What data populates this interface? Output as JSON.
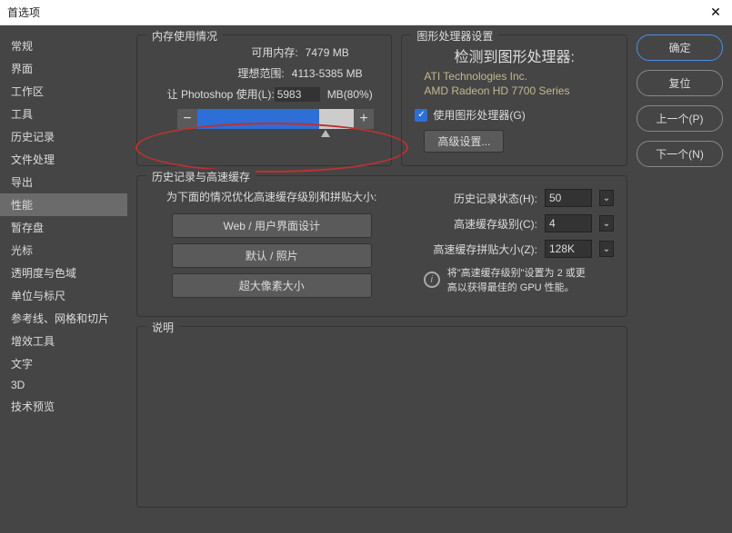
{
  "titlebar": {
    "title": "首选项"
  },
  "sidebar": {
    "items": [
      {
        "label": "常规"
      },
      {
        "label": "界面"
      },
      {
        "label": "工作区"
      },
      {
        "label": "工具"
      },
      {
        "label": "历史记录"
      },
      {
        "label": "文件处理"
      },
      {
        "label": "导出"
      },
      {
        "label": "性能"
      },
      {
        "label": "暂存盘"
      },
      {
        "label": "光标"
      },
      {
        "label": "透明度与色域"
      },
      {
        "label": "单位与标尺"
      },
      {
        "label": "参考线、网格和切片"
      },
      {
        "label": "增效工具"
      },
      {
        "label": "文字"
      },
      {
        "label": "3D"
      },
      {
        "label": "技术预览"
      }
    ],
    "selected_index": 7
  },
  "buttons": {
    "ok": "确定",
    "reset": "复位",
    "prev": "上一个(P)",
    "next": "下一个(N)"
  },
  "memory": {
    "title": "内存使用情况",
    "available_label": "可用内存:",
    "available_value": "7479 MB",
    "ideal_label": "理想范围:",
    "ideal_value": "4113-5385 MB",
    "let_label": "让 Photoshop 使用(L):",
    "let_value": "5983",
    "let_unit": "MB(80%)",
    "minus": "−",
    "plus": "+"
  },
  "gpu": {
    "title": "图形处理器设置",
    "detected_label": "检测到图形处理器:",
    "vendor": "ATI Technologies Inc.",
    "model": "AMD Radeon HD 7700 Series",
    "use_gpu": "使用图形处理器(G)",
    "advanced": "高级设置..."
  },
  "history": {
    "title": "历史记录与高速缓存",
    "desc": "为下面的情况优化高速缓存级别和拼贴大小:",
    "btn_web": "Web / 用户界面设计",
    "btn_default": "默认 / 照片",
    "btn_large": "超大像素大小",
    "states_label": "历史记录状态(H):",
    "states_value": "50",
    "cache_label": "高速缓存级别(C):",
    "cache_value": "4",
    "tile_label": "高速缓存拼贴大小(Z):",
    "tile_value": "128K",
    "tip": "将\"高速缓存级别\"设置为 2 或更高以获得最佳的 GPU 性能。"
  },
  "description": {
    "title": "说明"
  }
}
